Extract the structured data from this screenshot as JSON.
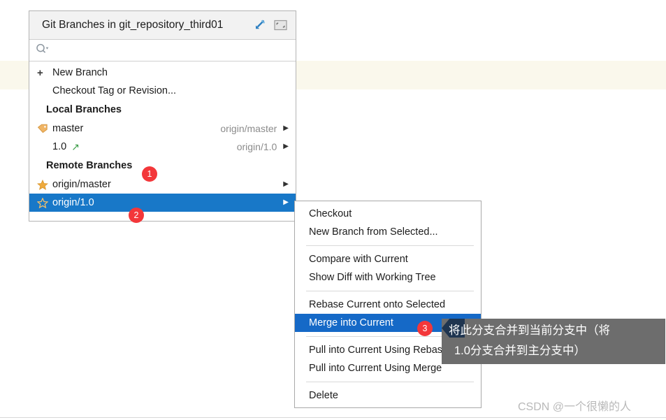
{
  "panel": {
    "title": "Git Branches in git_repository_third01",
    "title_icons": [
      {
        "name": "settings-arrow-icon",
        "glyph": "↙"
      },
      {
        "name": "restore-window-icon",
        "glyph": "⤡"
      }
    ],
    "search": {
      "placeholder": "",
      "value": "",
      "icon": "search-icon"
    },
    "actions": [
      {
        "label": "New Branch",
        "icon": "plus-icon"
      },
      {
        "label": "Checkout Tag or Revision...",
        "icon": ""
      }
    ],
    "local_section": {
      "header": "Local Branches",
      "items": [
        {
          "label": "master",
          "icon": "tag-icon",
          "tracking": "origin/master",
          "arrow": "▶",
          "badge": ""
        },
        {
          "label": "1.0",
          "icon": "green-arrow-icon",
          "tracking": "origin/1.0",
          "arrow": "▶",
          "badge": ""
        }
      ]
    },
    "remote_section": {
      "header": "Remote Branches",
      "header_badge": "1",
      "items": [
        {
          "label": "origin/master",
          "icon": "star-filled-icon",
          "tracking": "",
          "arrow": "▶",
          "selected": false,
          "badge": ""
        },
        {
          "label": "origin/1.0",
          "icon": "star-outline-icon",
          "tracking": "",
          "arrow": "▶",
          "selected": true,
          "badge": "2"
        }
      ]
    }
  },
  "context_menu": {
    "groups": [
      {
        "items": [
          {
            "label": "Checkout",
            "highlight": false
          },
          {
            "label": "New Branch from Selected...",
            "highlight": false
          }
        ]
      },
      {
        "items": [
          {
            "label": "Compare with Current",
            "highlight": false
          },
          {
            "label": "Show Diff with Working Tree",
            "highlight": false
          }
        ]
      },
      {
        "items": [
          {
            "label": "Rebase Current onto Selected",
            "highlight": false
          },
          {
            "label": "Merge into Current",
            "highlight": true,
            "badge": "3"
          }
        ]
      },
      {
        "items": [
          {
            "label": "Pull into Current Using Rebase",
            "highlight": false
          },
          {
            "label": "Pull into Current Using Merge",
            "highlight": false
          }
        ]
      },
      {
        "items": [
          {
            "label": "Delete",
            "highlight": false
          }
        ]
      }
    ]
  },
  "tooltip": {
    "line1": "将此分支合并到当前分支中（将",
    "line2": "1.0分支合并到主分支中）"
  },
  "badges": {
    "one": "1",
    "two": "2",
    "three": "3"
  },
  "watermark": "CSDN @一个很懒的人",
  "colors": {
    "selection_blue": "#1878c8",
    "menu_highlight_blue": "#1569c7",
    "badge_red": "#f3373a",
    "tooltip_gray": "#6d6d6d",
    "band_yellow": "#faf8ec"
  }
}
